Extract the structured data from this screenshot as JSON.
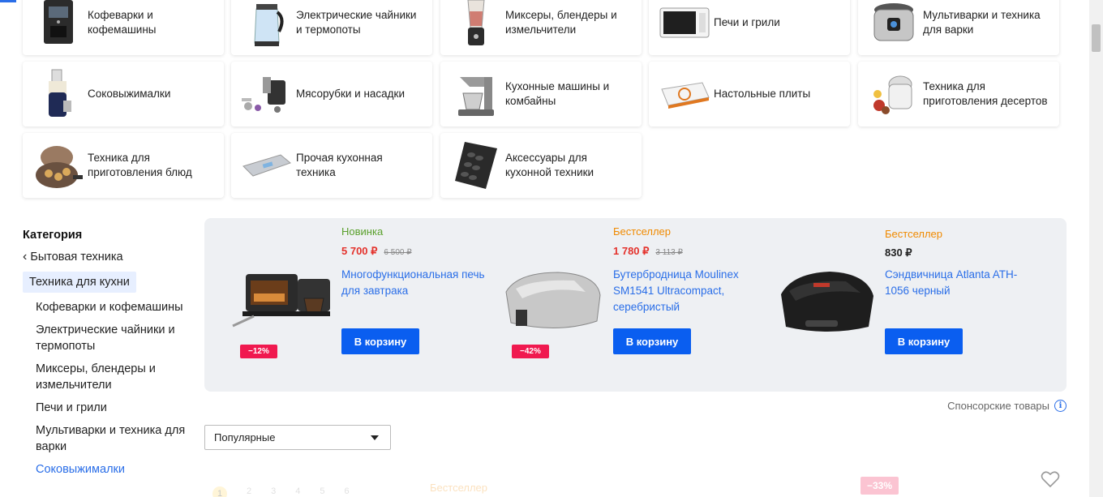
{
  "categories": [
    {
      "label": "Кофеварки и кофемашины",
      "icon": "coffee-machine-icon"
    },
    {
      "label": "Электрические чайники и термопоты",
      "icon": "kettle-icon"
    },
    {
      "label": "Миксеры, блендеры и измельчители",
      "icon": "blender-icon"
    },
    {
      "label": "Печи и грили",
      "icon": "microwave-icon"
    },
    {
      "label": "Мультиварки и техника для варки",
      "icon": "multicooker-icon"
    },
    {
      "label": "Соковыжималки",
      "icon": "juicer-icon"
    },
    {
      "label": "Мясорубки и насадки",
      "icon": "meat-grinder-icon"
    },
    {
      "label": "Кухонные машины и комбайны",
      "icon": "kitchen-machine-icon"
    },
    {
      "label": "Настольные плиты",
      "icon": "cooktop-icon"
    },
    {
      "label": "Техника для приготовления десертов",
      "icon": "ice-cream-maker-icon"
    },
    {
      "label": "Техника для приготовления блюд",
      "icon": "waffle-maker-icon"
    },
    {
      "label": "Прочая кухонная техника",
      "icon": "kitchen-scale-icon"
    },
    {
      "label": "Аксессуары для кухонной техники",
      "icon": "baking-tray-icon"
    }
  ],
  "sidebar": {
    "title": "Категория",
    "back_label": "Бытовая техника",
    "active_label": "Техника для кухни",
    "items": [
      {
        "label": "Кофеварки и кофемашины"
      },
      {
        "label": "Электрические чайники и термопоты"
      },
      {
        "label": "Миксеры, блендеры и измельчители"
      },
      {
        "label": "Печи и грили"
      },
      {
        "label": "Мультиварки и техника для варки"
      },
      {
        "label": "Соковыжималки"
      }
    ]
  },
  "promo": [
    {
      "tag": "Новинка",
      "tag_color": "#5aa02c",
      "price": "5 700 ₽",
      "old_price": "6 500 ₽",
      "name": "Многофункциональная печь для завтрака",
      "badge": "−12%",
      "button": "В корзину",
      "icon": "breakfast-oven-icon"
    },
    {
      "tag": "Бестселлер",
      "tag_color": "#f08a00",
      "price": "1 780 ₽",
      "old_price": "3 113 ₽",
      "name": "Бутербродница Moulinex SM1541 Ultracompact, серебристый",
      "badge": "−42%",
      "button": "В корзину",
      "icon": "sandwich-maker-silver-icon"
    },
    {
      "tag": "Бестселлер",
      "tag_color": "#f08a00",
      "price": "830 ₽",
      "old_price": "",
      "name": "Сэндвичница Atlanta ATH-1056 черный",
      "badge": "",
      "button": "В корзину",
      "icon": "sandwich-maker-black-icon"
    }
  ],
  "sponsor_label": "Спонсорские товары",
  "sort": {
    "value": "Популярные"
  },
  "below": {
    "pages": [
      "1",
      "2",
      "3",
      "4",
      "5",
      "6"
    ],
    "tag": "Бестселлер",
    "badge": "−33%"
  },
  "colors": {
    "accent": "#0a5ef0",
    "link": "#2a6ee8",
    "sale": "#f0194f"
  }
}
